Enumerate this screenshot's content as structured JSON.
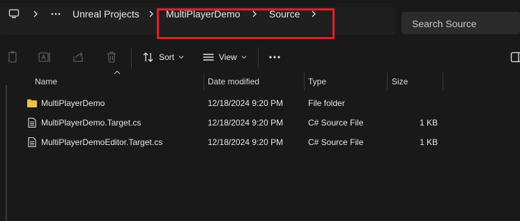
{
  "address_bar": {
    "breadcrumbs": [
      "Unreal Projects",
      "MultiPlayerDemo",
      "Source"
    ]
  },
  "search": {
    "placeholder": "Search Source"
  },
  "toolbar": {
    "sort_label": "Sort",
    "view_label": "View"
  },
  "columns": [
    "Name",
    "Date modified",
    "Type",
    "Size"
  ],
  "files": [
    {
      "name": "MultiPlayerDemo",
      "date": "12/18/2024 9:20 PM",
      "type": "File folder",
      "size": ""
    },
    {
      "name": "MultiPlayerDemo.Target.cs",
      "date": "12/18/2024 9:20 PM",
      "type": "C# Source File",
      "size": "1 KB"
    },
    {
      "name": "MultiPlayerDemoEditor.Target.cs",
      "date": "12/18/2024 9:20 PM",
      "type": "C# Source File",
      "size": "1 KB"
    }
  ],
  "colors": {
    "highlight": "#e41e2b",
    "folder": "#f2c14e",
    "background": "#191919"
  },
  "icons": [
    "pc-icon",
    "chevron-right-icon",
    "more-icon",
    "folder-icon",
    "document-icon",
    "copy-icon",
    "rename-icon",
    "share-icon",
    "delete-icon",
    "sort-icon",
    "view-icon",
    "details-pane-icon"
  ]
}
